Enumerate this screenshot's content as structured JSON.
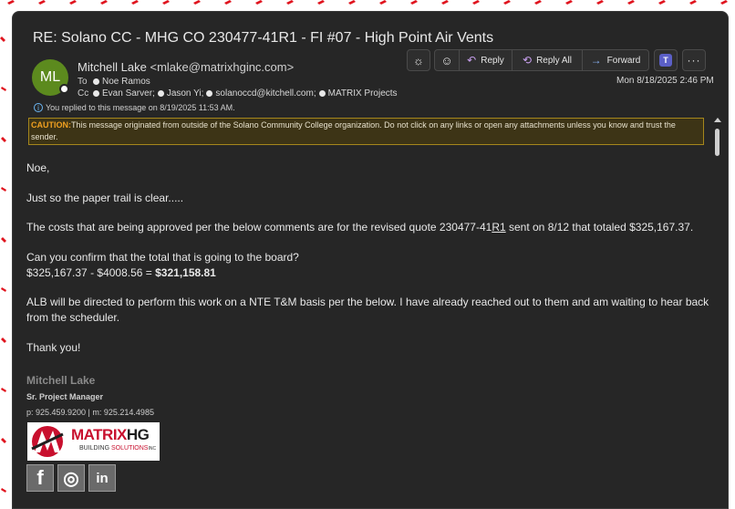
{
  "email": {
    "subject": "RE: Solano CC - MHG CO 230477-41R1 - FI #07 - High Point Air Vents",
    "avatar_initials": "ML",
    "sender_name": "Mitchell Lake",
    "sender_email": "<mlake@matrixhginc.com>",
    "to_label": "To",
    "to": [
      "Noe Ramos"
    ],
    "cc_label": "Cc",
    "cc": [
      "Evan Sarver;",
      "Jason Yi;",
      "solanoccd@kitchell.com;",
      "MATRIX Projects"
    ],
    "replied_notice": "You replied to this message on 8/19/2025 11:53 AM.",
    "date": "Mon 8/18/2025 2:46 PM"
  },
  "toolbar": {
    "reply": "Reply",
    "reply_all": "Reply All",
    "forward": "Forward"
  },
  "caution": {
    "label": "CAUTION:",
    "text": "This message originated from outside of the Solano Community College organization. Do not click on any links or open any attachments unless you know and trust the sender."
  },
  "body": {
    "greeting": "Noe,",
    "p1": "Just so the paper trail is clear.....",
    "p2_pre": "The costs that are being approved per the below comments are for the revised quote 230477-41",
    "p2_u": "R1",
    "p2_post": " sent on 8/12 that totaled $325,167.37.",
    "p3": "Can you confirm that the total that is going to the board?",
    "p4_pre": "$325,167.37 - $4008.56 = ",
    "p4_bold": "$321,158.81",
    "p5a": "ALB will be directed to perform this work on a NTE T&M basis per the below. I have already reached out to them and am waiting to hear back",
    "p5b": "from the scheduler.",
    "closing": "Thank you!"
  },
  "signature": {
    "name": "Mitchell Lake",
    "title": "Sr. Project Manager",
    "phone": "p: 925.459.9200 | m: 925.214.4985",
    "logo_brand_a": "MATRIX",
    "logo_brand_b": "HG",
    "logo_sub_a": "BUILDING ",
    "logo_sub_b": "SOLUTIONS",
    "logo_sub_c": "INC",
    "social": [
      "f",
      "◎",
      "in"
    ]
  }
}
